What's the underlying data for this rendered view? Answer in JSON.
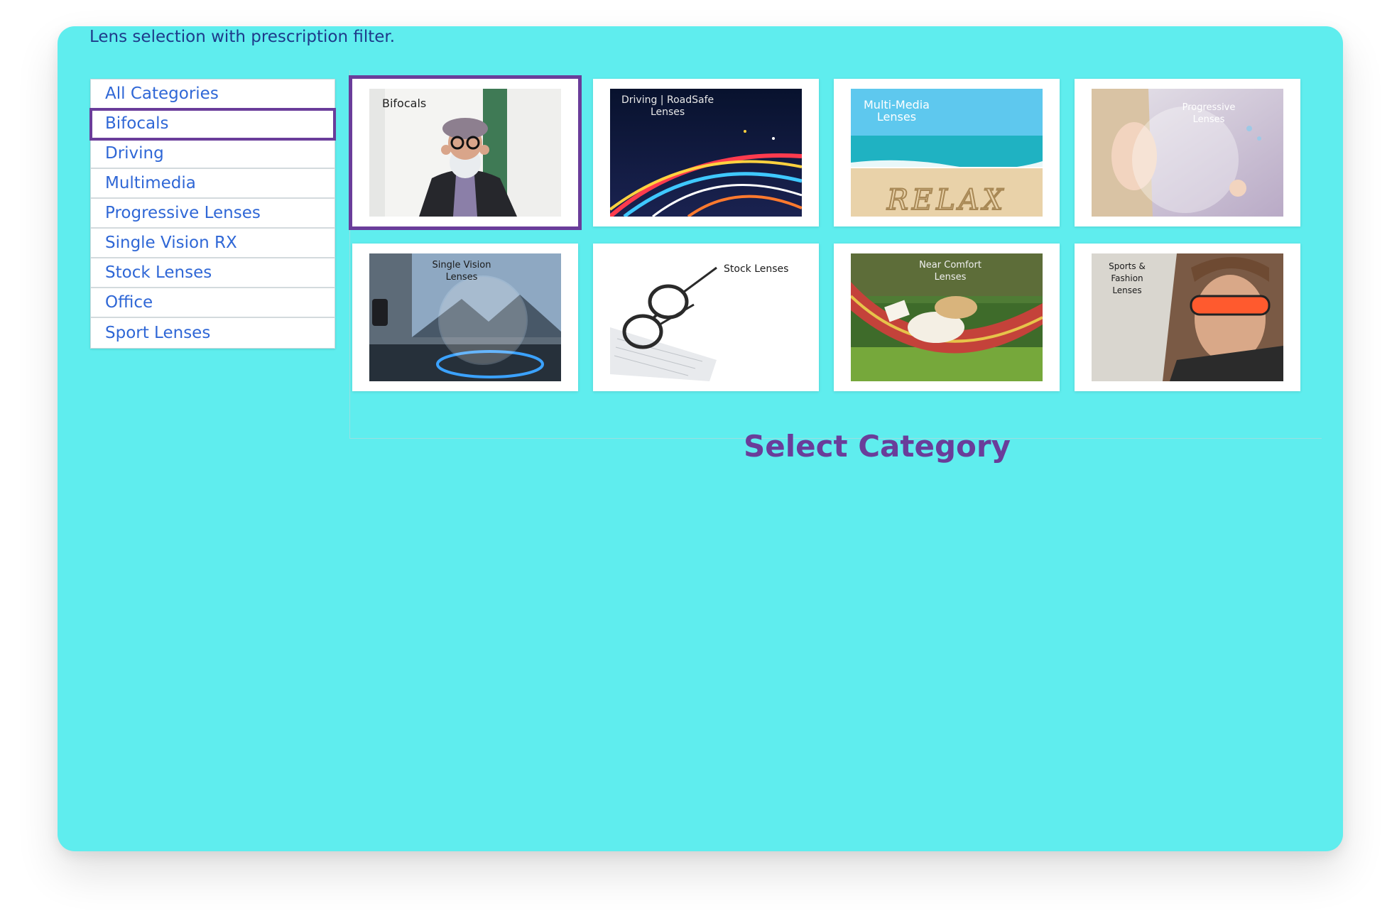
{
  "caption": "Lens selection with prescription filter.",
  "sidebar": {
    "items": [
      {
        "label": "All Categories"
      },
      {
        "label": "Bifocals"
      },
      {
        "label": "Driving"
      },
      {
        "label": "Multimedia"
      },
      {
        "label": "Progressive Lenses"
      },
      {
        "label": "Single Vision RX"
      },
      {
        "label": "Stock Lenses"
      },
      {
        "label": "Office"
      },
      {
        "label": "Sport Lenses"
      }
    ],
    "selected": "Bifocals"
  },
  "cards": [
    {
      "label": "Bifocals"
    },
    {
      "label": "Driving | RoadSafe\nLenses"
    },
    {
      "label": "Multi-Media\nLenses"
    },
    {
      "label": "Progressive\nLenses"
    },
    {
      "label": "Single Vision\nLenses"
    },
    {
      "label": "Stock Lenses"
    },
    {
      "label": "Near Comfort\nLenses"
    },
    {
      "label": "Sports & Fashion\nLenses"
    }
  ],
  "thumb_words": {
    "relax": "RELAX"
  },
  "heading": "Select Category",
  "colors": {
    "panel": "#5fedee",
    "accent": "#6a3d9a",
    "link": "#2f67d6",
    "caption": "#1e3a8a"
  }
}
